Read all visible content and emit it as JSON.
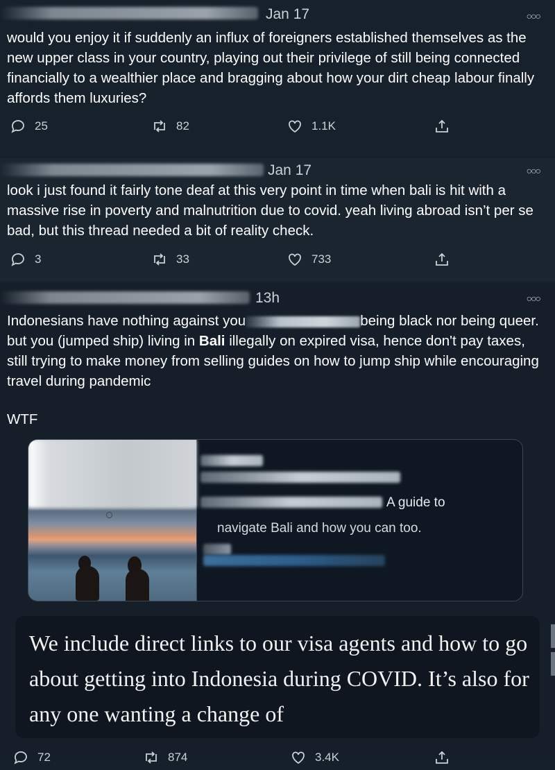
{
  "tweets": [
    {
      "date": "Jan 17",
      "text": "would you enjoy it if suddenly an influx of foreigners established themselves as the new upper class in your country, playing out their privilege of still being connected financially to a wealthier place and bragging about how your dirt cheap labour finally affords them luxuries?",
      "replies": "25",
      "retweets": "82",
      "likes": "1.1K"
    },
    {
      "date": "Jan 17",
      "text": "look i just found it fairly tone deaf at this very point in time when bali is hit with a massive rise in poverty and malnutrition due to covid. yeah living abroad isn’t per se bad, but this thread needed a bit of reality check.",
      "replies": "3",
      "retweets": "33",
      "likes": "733"
    },
    {
      "date": "13h",
      "text_a": "Indonesians have nothing against you",
      "text_b": "being black nor being queer. but you (jumped ship) living in ",
      "bold": "Bali",
      "text_c": " illegally on expired visa, hence don't pay taxes, still trying to make money from selling guides on how to jump ship while encouraging travel during pandemic",
      "wtf": "WTF",
      "card_line1": "A guide to",
      "card_line2": "navigate Bali and how you can too.",
      "quote": "We include direct links to our visa agents and how to go about getting into Indonesia during COVID. It’s also for any one wanting a change of",
      "replies": "72",
      "retweets": "874",
      "likes": "3.4K"
    }
  ],
  "icons": {
    "more": "more-icon",
    "reply": "reply-icon",
    "retweet": "retweet-icon",
    "like": "heart-icon",
    "share": "share-icon"
  },
  "colors": {
    "background": "#15202b",
    "muted": "#c9d1d9"
  }
}
